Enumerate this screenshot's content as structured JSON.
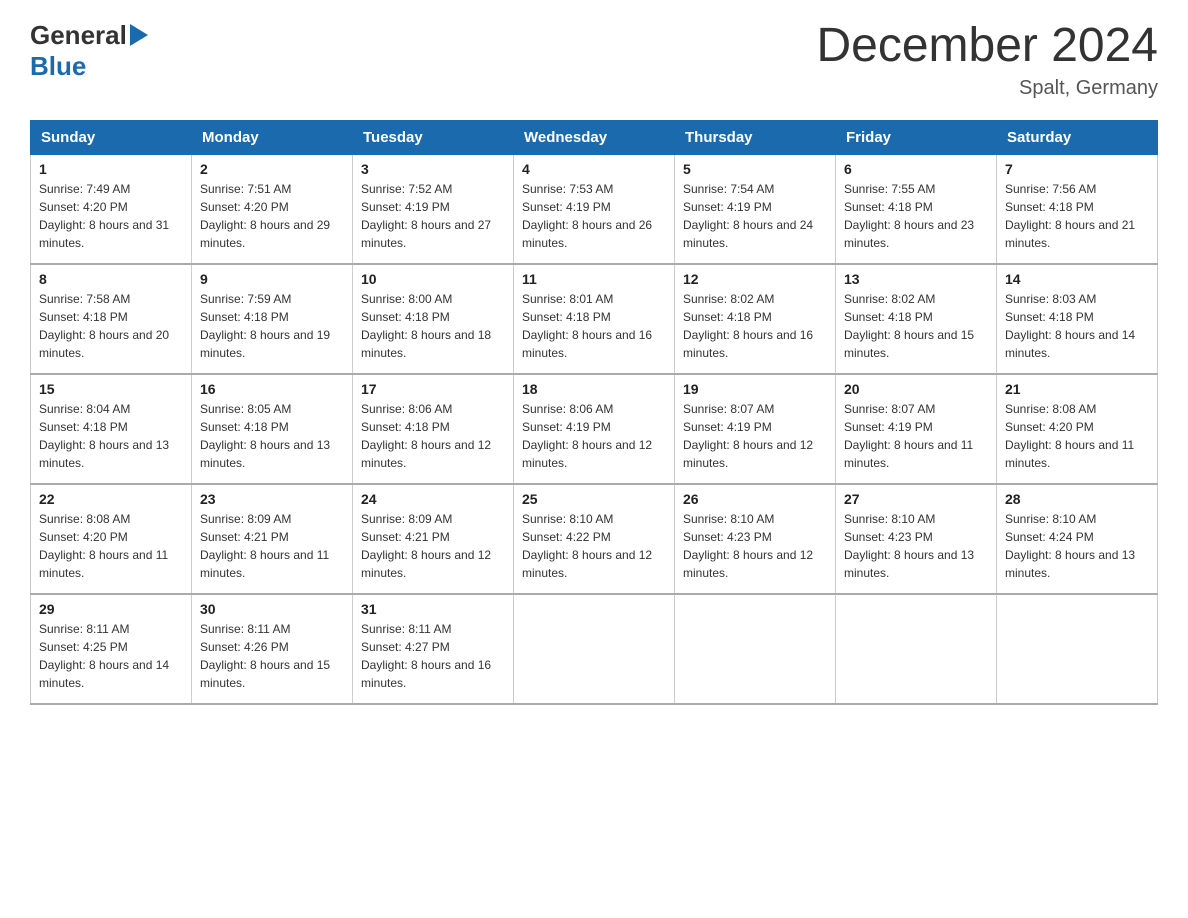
{
  "header": {
    "logo_general": "General",
    "logo_blue": "Blue",
    "month_title": "December 2024",
    "location": "Spalt, Germany"
  },
  "calendar": {
    "days_of_week": [
      "Sunday",
      "Monday",
      "Tuesday",
      "Wednesday",
      "Thursday",
      "Friday",
      "Saturday"
    ],
    "weeks": [
      [
        {
          "day": "1",
          "sunrise": "7:49 AM",
          "sunset": "4:20 PM",
          "daylight": "8 hours and 31 minutes."
        },
        {
          "day": "2",
          "sunrise": "7:51 AM",
          "sunset": "4:20 PM",
          "daylight": "8 hours and 29 minutes."
        },
        {
          "day": "3",
          "sunrise": "7:52 AM",
          "sunset": "4:19 PM",
          "daylight": "8 hours and 27 minutes."
        },
        {
          "day": "4",
          "sunrise": "7:53 AM",
          "sunset": "4:19 PM",
          "daylight": "8 hours and 26 minutes."
        },
        {
          "day": "5",
          "sunrise": "7:54 AM",
          "sunset": "4:19 PM",
          "daylight": "8 hours and 24 minutes."
        },
        {
          "day": "6",
          "sunrise": "7:55 AM",
          "sunset": "4:18 PM",
          "daylight": "8 hours and 23 minutes."
        },
        {
          "day": "7",
          "sunrise": "7:56 AM",
          "sunset": "4:18 PM",
          "daylight": "8 hours and 21 minutes."
        }
      ],
      [
        {
          "day": "8",
          "sunrise": "7:58 AM",
          "sunset": "4:18 PM",
          "daylight": "8 hours and 20 minutes."
        },
        {
          "day": "9",
          "sunrise": "7:59 AM",
          "sunset": "4:18 PM",
          "daylight": "8 hours and 19 minutes."
        },
        {
          "day": "10",
          "sunrise": "8:00 AM",
          "sunset": "4:18 PM",
          "daylight": "8 hours and 18 minutes."
        },
        {
          "day": "11",
          "sunrise": "8:01 AM",
          "sunset": "4:18 PM",
          "daylight": "8 hours and 16 minutes."
        },
        {
          "day": "12",
          "sunrise": "8:02 AM",
          "sunset": "4:18 PM",
          "daylight": "8 hours and 16 minutes."
        },
        {
          "day": "13",
          "sunrise": "8:02 AM",
          "sunset": "4:18 PM",
          "daylight": "8 hours and 15 minutes."
        },
        {
          "day": "14",
          "sunrise": "8:03 AM",
          "sunset": "4:18 PM",
          "daylight": "8 hours and 14 minutes."
        }
      ],
      [
        {
          "day": "15",
          "sunrise": "8:04 AM",
          "sunset": "4:18 PM",
          "daylight": "8 hours and 13 minutes."
        },
        {
          "day": "16",
          "sunrise": "8:05 AM",
          "sunset": "4:18 PM",
          "daylight": "8 hours and 13 minutes."
        },
        {
          "day": "17",
          "sunrise": "8:06 AM",
          "sunset": "4:18 PM",
          "daylight": "8 hours and 12 minutes."
        },
        {
          "day": "18",
          "sunrise": "8:06 AM",
          "sunset": "4:19 PM",
          "daylight": "8 hours and 12 minutes."
        },
        {
          "day": "19",
          "sunrise": "8:07 AM",
          "sunset": "4:19 PM",
          "daylight": "8 hours and 12 minutes."
        },
        {
          "day": "20",
          "sunrise": "8:07 AM",
          "sunset": "4:19 PM",
          "daylight": "8 hours and 11 minutes."
        },
        {
          "day": "21",
          "sunrise": "8:08 AM",
          "sunset": "4:20 PM",
          "daylight": "8 hours and 11 minutes."
        }
      ],
      [
        {
          "day": "22",
          "sunrise": "8:08 AM",
          "sunset": "4:20 PM",
          "daylight": "8 hours and 11 minutes."
        },
        {
          "day": "23",
          "sunrise": "8:09 AM",
          "sunset": "4:21 PM",
          "daylight": "8 hours and 11 minutes."
        },
        {
          "day": "24",
          "sunrise": "8:09 AM",
          "sunset": "4:21 PM",
          "daylight": "8 hours and 12 minutes."
        },
        {
          "day": "25",
          "sunrise": "8:10 AM",
          "sunset": "4:22 PM",
          "daylight": "8 hours and 12 minutes."
        },
        {
          "day": "26",
          "sunrise": "8:10 AM",
          "sunset": "4:23 PM",
          "daylight": "8 hours and 12 minutes."
        },
        {
          "day": "27",
          "sunrise": "8:10 AM",
          "sunset": "4:23 PM",
          "daylight": "8 hours and 13 minutes."
        },
        {
          "day": "28",
          "sunrise": "8:10 AM",
          "sunset": "4:24 PM",
          "daylight": "8 hours and 13 minutes."
        }
      ],
      [
        {
          "day": "29",
          "sunrise": "8:11 AM",
          "sunset": "4:25 PM",
          "daylight": "8 hours and 14 minutes."
        },
        {
          "day": "30",
          "sunrise": "8:11 AM",
          "sunset": "4:26 PM",
          "daylight": "8 hours and 15 minutes."
        },
        {
          "day": "31",
          "sunrise": "8:11 AM",
          "sunset": "4:27 PM",
          "daylight": "8 hours and 16 minutes."
        },
        null,
        null,
        null,
        null
      ]
    ]
  }
}
